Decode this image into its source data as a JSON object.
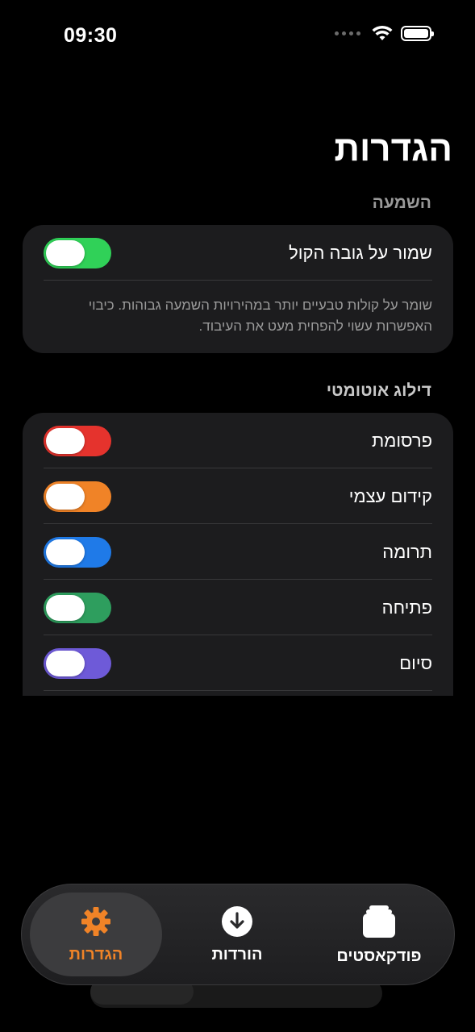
{
  "status_bar": {
    "time": "09:30"
  },
  "page": {
    "title": "הגדרות"
  },
  "listening": {
    "header": "השמעה",
    "keep_volume_label": "שמור על גובה הקול",
    "description": "שומר על קולות טבעיים יותר במהירויות השמעה גבוהות. כיבוי האפשרות עשוי להפחית מעט את העיבוד.",
    "toggle_color": "#30d158"
  },
  "auto_skip": {
    "header": "דילוג אוטומטי",
    "items": [
      {
        "label": "פרסומת",
        "color": "#e5332d"
      },
      {
        "label": "קידום עצמי",
        "color": "#f08327"
      },
      {
        "label": "תרומה",
        "color": "#1f7ae8"
      },
      {
        "label": "פתיחה",
        "color": "#2e9e5e"
      },
      {
        "label": "סיום",
        "color": "#6e5ad8"
      }
    ]
  },
  "tab_bar": {
    "tabs": [
      {
        "label": "פודקאסטים",
        "icon": "stack-icon",
        "active": false
      },
      {
        "label": "הורדות",
        "icon": "download-icon",
        "active": false
      },
      {
        "label": "הגדרות",
        "icon": "gear-icon",
        "active": true
      }
    ],
    "active_color": "#f08327"
  }
}
